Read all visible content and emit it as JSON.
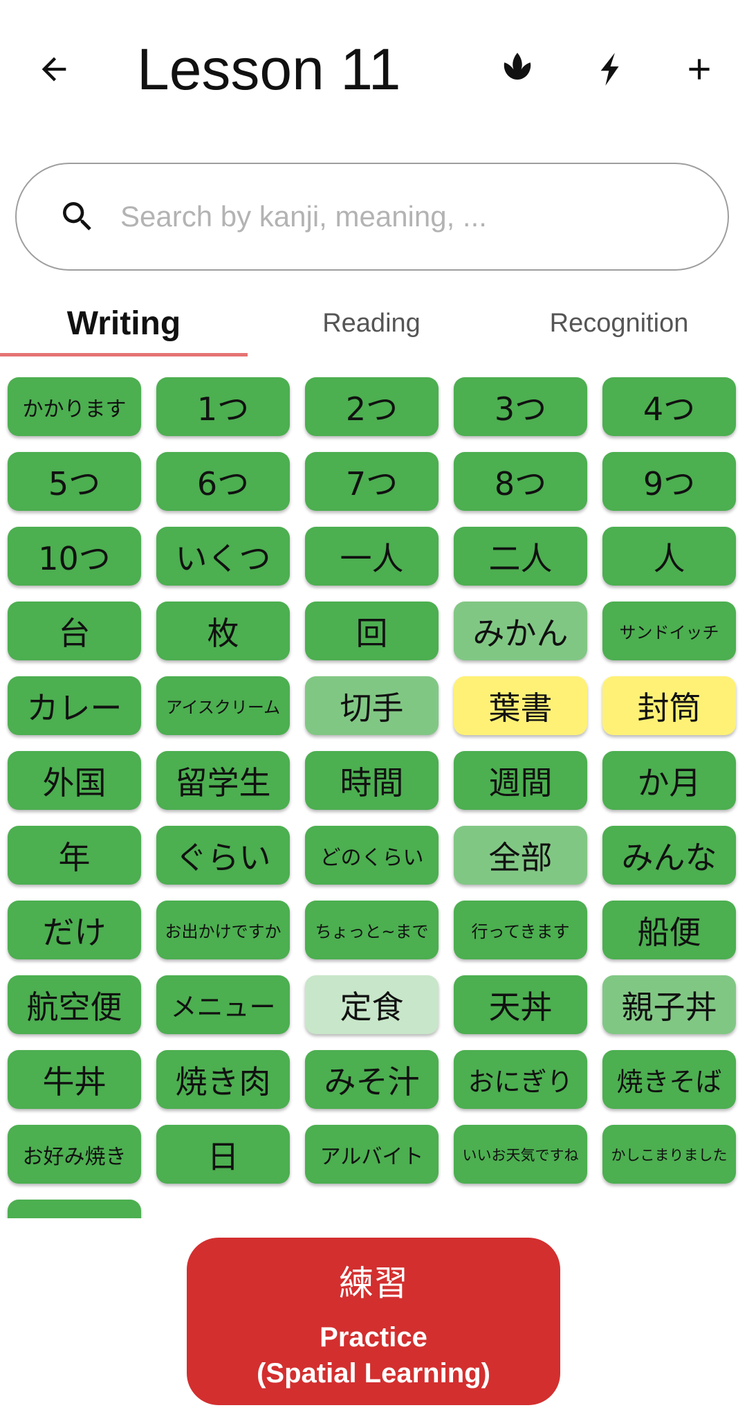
{
  "header": {
    "title": "Lesson 11",
    "icons": [
      "arrow-back-icon",
      "lotus-icon",
      "bolt-icon",
      "plus-icon"
    ]
  },
  "search": {
    "placeholder": "Search by kanji, meaning, ..."
  },
  "tabs": [
    {
      "label": "Writing",
      "active": true
    },
    {
      "label": "Reading",
      "active": false
    },
    {
      "label": "Recognition",
      "active": false
    }
  ],
  "status_colors": {
    "green": "#4caf50",
    "light": "#81c784",
    "pale": "#c8e6c9",
    "yellow": "#fff176"
  },
  "items": [
    {
      "text": "かかります",
      "status": "green"
    },
    {
      "text": "1つ",
      "status": "green"
    },
    {
      "text": "2つ",
      "status": "green"
    },
    {
      "text": "3つ",
      "status": "green"
    },
    {
      "text": "4つ",
      "status": "green"
    },
    {
      "text": "5つ",
      "status": "green"
    },
    {
      "text": "6つ",
      "status": "green"
    },
    {
      "text": "7つ",
      "status": "green"
    },
    {
      "text": "8つ",
      "status": "green"
    },
    {
      "text": "9つ",
      "status": "green"
    },
    {
      "text": "10つ",
      "status": "green"
    },
    {
      "text": "いくつ",
      "status": "green"
    },
    {
      "text": "一人",
      "status": "green"
    },
    {
      "text": "二人",
      "status": "green"
    },
    {
      "text": "人",
      "status": "green"
    },
    {
      "text": "台",
      "status": "green"
    },
    {
      "text": "枚",
      "status": "green"
    },
    {
      "text": "回",
      "status": "green"
    },
    {
      "text": "みかん",
      "status": "light"
    },
    {
      "text": "サンドイッチ",
      "status": "green"
    },
    {
      "text": "カレー",
      "status": "green"
    },
    {
      "text": "アイスクリーム",
      "status": "green"
    },
    {
      "text": "切手",
      "status": "light"
    },
    {
      "text": "葉書",
      "status": "yellow"
    },
    {
      "text": "封筒",
      "status": "yellow"
    },
    {
      "text": "外国",
      "status": "green"
    },
    {
      "text": "留学生",
      "status": "green"
    },
    {
      "text": "時間",
      "status": "green"
    },
    {
      "text": "週間",
      "status": "green"
    },
    {
      "text": "か月",
      "status": "green"
    },
    {
      "text": "年",
      "status": "green"
    },
    {
      "text": "ぐらい",
      "status": "green"
    },
    {
      "text": "どのくらい",
      "status": "green"
    },
    {
      "text": "全部",
      "status": "light"
    },
    {
      "text": "みんな",
      "status": "green"
    },
    {
      "text": "だけ",
      "status": "green"
    },
    {
      "text": "お出かけですか",
      "status": "green"
    },
    {
      "text": "ちょっと~まで",
      "status": "green"
    },
    {
      "text": "行ってきます",
      "status": "green"
    },
    {
      "text": "船便",
      "status": "green"
    },
    {
      "text": "航空便",
      "status": "green"
    },
    {
      "text": "メニュー",
      "status": "green"
    },
    {
      "text": "定食",
      "status": "pale"
    },
    {
      "text": "天丼",
      "status": "green"
    },
    {
      "text": "親子丼",
      "status": "light"
    },
    {
      "text": "牛丼",
      "status": "green"
    },
    {
      "text": "焼き肉",
      "status": "green"
    },
    {
      "text": "みそ汁",
      "status": "green"
    },
    {
      "text": "おにぎり",
      "status": "green"
    },
    {
      "text": "焼きそば",
      "status": "green"
    },
    {
      "text": "お好み焼き",
      "status": "green"
    },
    {
      "text": "日",
      "status": "green"
    },
    {
      "text": "アルバイト",
      "status": "green"
    },
    {
      "text": "いいお天気ですね",
      "status": "green"
    },
    {
      "text": "かしこまりました",
      "status": "green"
    },
    {
      "text": "",
      "status": "green"
    }
  ],
  "practice": {
    "kanji": "練習",
    "line1": "Practice",
    "line2": "(Spatial Learning)"
  }
}
